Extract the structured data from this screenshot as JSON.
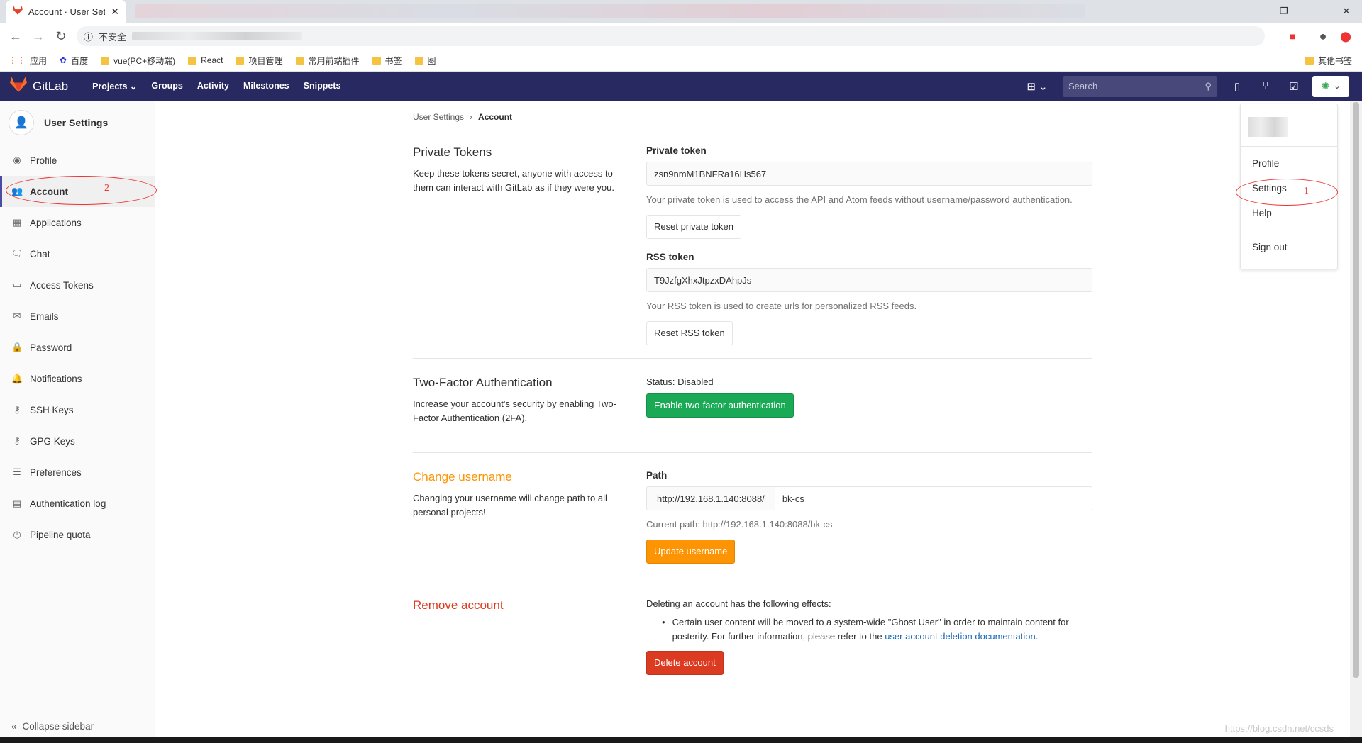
{
  "browser": {
    "tab_title": "Account · User Set",
    "insecure_label": "不安全",
    "bookmarks": [
      "应用",
      "百度",
      "vue(PC+移动端)",
      "React",
      "项目管理",
      "常用前端插件",
      "书签",
      "图"
    ],
    "other_bookmarks": "其他书签"
  },
  "header": {
    "brand": "GitLab",
    "nav": [
      "Projects",
      "Groups",
      "Activity",
      "Milestones",
      "Snippets"
    ],
    "search_placeholder": "Search"
  },
  "sidebar": {
    "title": "User Settings",
    "items": [
      {
        "label": "Profile",
        "icon": "profile-icon"
      },
      {
        "label": "Account",
        "icon": "account-icon",
        "active": true
      },
      {
        "label": "Applications",
        "icon": "applications-icon"
      },
      {
        "label": "Chat",
        "icon": "chat-icon"
      },
      {
        "label": "Access Tokens",
        "icon": "token-icon"
      },
      {
        "label": "Emails",
        "icon": "mail-icon"
      },
      {
        "label": "Password",
        "icon": "lock-icon"
      },
      {
        "label": "Notifications",
        "icon": "bell-icon"
      },
      {
        "label": "SSH Keys",
        "icon": "key-icon"
      },
      {
        "label": "GPG Keys",
        "icon": "key-icon"
      },
      {
        "label": "Preferences",
        "icon": "sliders-icon"
      },
      {
        "label": "Authentication log",
        "icon": "log-icon"
      },
      {
        "label": "Pipeline quota",
        "icon": "quota-icon"
      }
    ],
    "collapse_label": "Collapse sidebar"
  },
  "annotations": {
    "settings_number": "1",
    "account_number": "2"
  },
  "breadcrumb": {
    "parent": "User Settings",
    "current": "Account"
  },
  "private_tokens": {
    "title": "Private Tokens",
    "description": "Keep these tokens secret, anyone with access to them can interact with GitLab as if they were you.",
    "private_label": "Private token",
    "private_value": "zsn9nmM1BNFRa16Hs567",
    "private_help": "Your private token is used to access the API and Atom feeds without username/password authentication.",
    "reset_private": "Reset private token",
    "rss_label": "RSS token",
    "rss_value": "T9JzfgXhxJtpzxDAhpJs",
    "rss_help": "Your RSS token is used to create urls for personalized RSS feeds.",
    "reset_rss": "Reset RSS token"
  },
  "two_factor": {
    "title": "Two-Factor Authentication",
    "description": "Increase your account's security by enabling Two-Factor Authentication (2FA).",
    "status": "Status: Disabled",
    "button": "Enable two-factor authentication"
  },
  "change_username": {
    "title": "Change username",
    "description": "Changing your username will change path to all personal projects!",
    "path_label": "Path",
    "path_prefix": "http://192.168.1.140:8088/",
    "username": "bk-cs",
    "current_path": "Current path: http://192.168.1.140:8088/bk-cs",
    "button": "Update username"
  },
  "remove_account": {
    "title": "Remove account",
    "intro": "Deleting an account has the following effects:",
    "bullet": "Certain user content will be moved to a system-wide \"Ghost User\" in order to maintain content for posterity. For further information, please refer to the",
    "link": "user account deletion documentation",
    "link_end": ".",
    "button": "Delete account"
  },
  "dropdown": {
    "items": [
      "Profile",
      "Settings",
      "Help",
      "Sign out"
    ]
  },
  "watermark": "https://blog.csdn.net/ccsds"
}
